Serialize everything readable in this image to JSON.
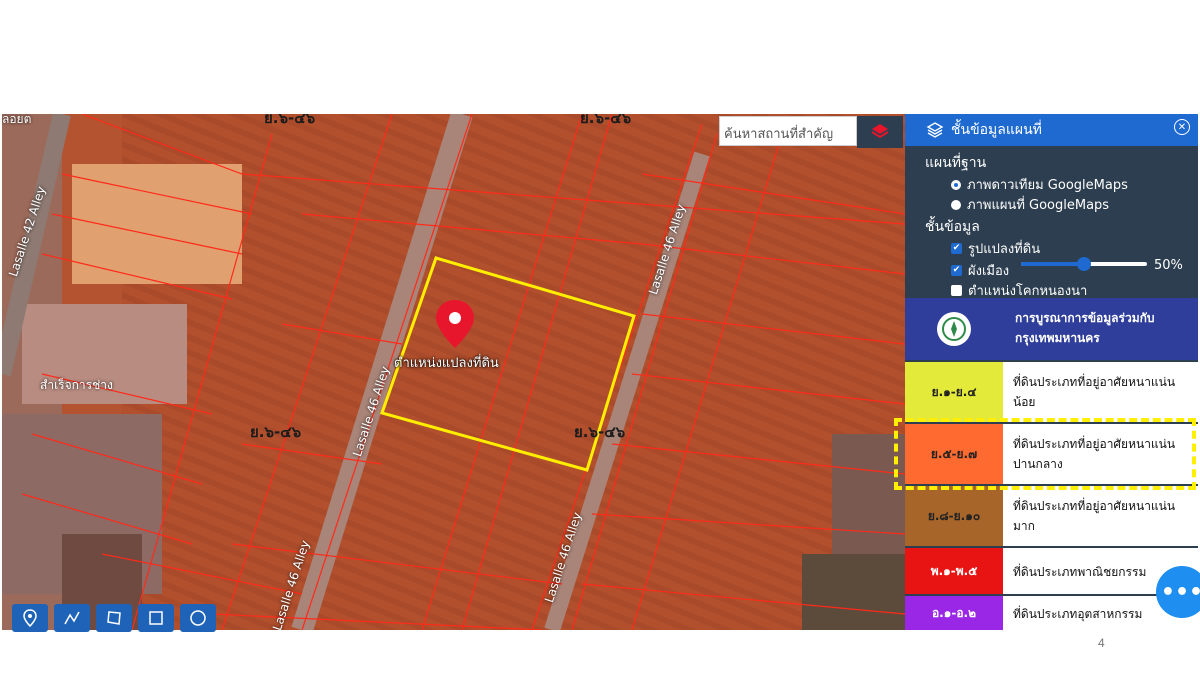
{
  "slide": {
    "page_number": "4"
  },
  "map": {
    "search_placeholder": "ค้นหาสถานที่สำคัญ",
    "parcel_label": "ตำแหน่งแปลงที่ดิน",
    "zone_labels": [
      "ย.๖-๔๖",
      "ย.๖-๔๖",
      "ย.๖-๔๖",
      "ย.๖-๔๖"
    ],
    "road_labels": [
      "Lasalle 42 Alley",
      "Lasalle 46 Alley",
      "Lasalle 46 Alley",
      "Lasalle 46 Alley",
      "Lasalle 46 Alley"
    ],
    "poi_labels": [
      "สำเร็จการช่าง",
      "ลอยต"
    ],
    "tool_icons": [
      "pin-icon",
      "line-icon",
      "polygon-icon",
      "rectangle-icon",
      "circle-icon"
    ]
  },
  "panel": {
    "title": "ชั้นข้อมูลแผนที่",
    "basemap_label": "แผนที่ฐาน",
    "basemap_options": [
      {
        "label": "ภาพดาวเทียม GoogleMaps",
        "selected": true
      },
      {
        "label": "ภาพแผนที่ GoogleMaps",
        "selected": false
      }
    ],
    "layers_label": "ชั้นข้อมูล",
    "layers": [
      {
        "label": "รูปแปลงที่ดิน",
        "checked": true
      },
      {
        "label": "ผังเมือง",
        "checked": true
      },
      {
        "label": "ตำแหน่งโคกหนองนา",
        "checked": false
      }
    ],
    "opacity": {
      "value": 0.5,
      "text": "50%"
    },
    "bma_text_1": "การบูรณาการข้อมูลร่วมกับ",
    "bma_text_2": "กรุงเทพมหานคร",
    "legend": [
      {
        "code": "ย.๑-ย.๔",
        "text": "ที่ดินประเภทที่อยู่อาศัยหนาแน่นน้อย",
        "color": "#e4ea3a"
      },
      {
        "code": "ย.๕-ย.๗",
        "text": "ที่ดินประเภทที่อยู่อาศัยหนาแน่นปานกลาง",
        "color": "#ff6a30"
      },
      {
        "code": "ย.๘-ย.๑๐",
        "text": "ที่ดินประเภทที่อยู่อาศัยหนาแน่นมาก",
        "color": "#a8652a"
      },
      {
        "code": "พ.๑-พ.๕",
        "text": "ที่ดินประเภทพาณิชยกรรม",
        "color": "#e81313"
      },
      {
        "code": "อ.๑-อ.๒",
        "text": "ที่ดินประเภทอุตสาหกรรม",
        "color": "#9b27e6"
      }
    ]
  },
  "colors": {
    "accent": "#1e6ad0",
    "panel_bg": "#2c3e4f",
    "highlight": "#ffef00",
    "parcel": "#ffee00",
    "marker": "#e8162c"
  }
}
